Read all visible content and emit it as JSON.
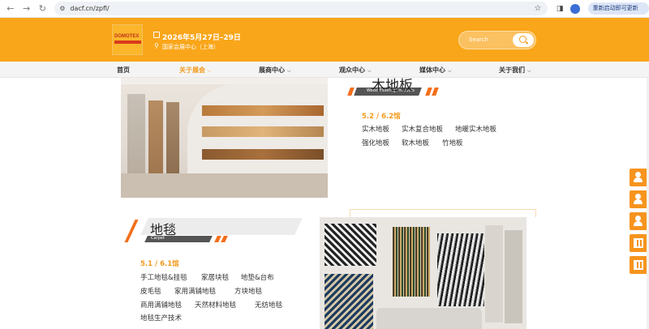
{
  "browser": {
    "url": "dacf.cn/zpfl/",
    "update_label": "重新启动即可更新",
    "update_dots": "⋮"
  },
  "header": {
    "logo_text": "DOMOTEX",
    "event_date": "2026年5月27日–29日",
    "event_venue": "国家会展中心（上海）",
    "search_placeholder": "Search"
  },
  "nav": {
    "items": [
      {
        "label": "首页",
        "active": false,
        "has_dropdown": false
      },
      {
        "label": "关于展会",
        "active": true,
        "has_dropdown": true
      },
      {
        "label": "展商中心",
        "active": false,
        "has_dropdown": true
      },
      {
        "label": "观众中心",
        "active": false,
        "has_dropdown": true
      },
      {
        "label": "媒体中心",
        "active": false,
        "has_dropdown": true
      },
      {
        "label": "关于我们",
        "active": false,
        "has_dropdown": true
      }
    ]
  },
  "wood_section": {
    "title": "木地板",
    "subtitle": "Wood Flooring Products",
    "hall": "5.2 / 6.2馆",
    "tags": [
      "实木地板",
      "实木复合地板",
      "地暖实木地板",
      "强化地板",
      "软木地板",
      "竹地板"
    ]
  },
  "carpet_section": {
    "title": "地毯",
    "subtitle": "Carpet",
    "hall": "5.1 / 6.1馆",
    "tags": [
      "手工地毯&挂毯",
      "家居块毯",
      "地垫&台布",
      "皮毛毯",
      "家用满铺地毯",
      "方块地毯",
      "商用满铺地毯",
      "天然材料地毯",
      "无纺地毯",
      "地毯生产技术"
    ]
  },
  "colors": {
    "brand_orange": "#f9a61a",
    "accent_orange": "#f29a1a"
  }
}
